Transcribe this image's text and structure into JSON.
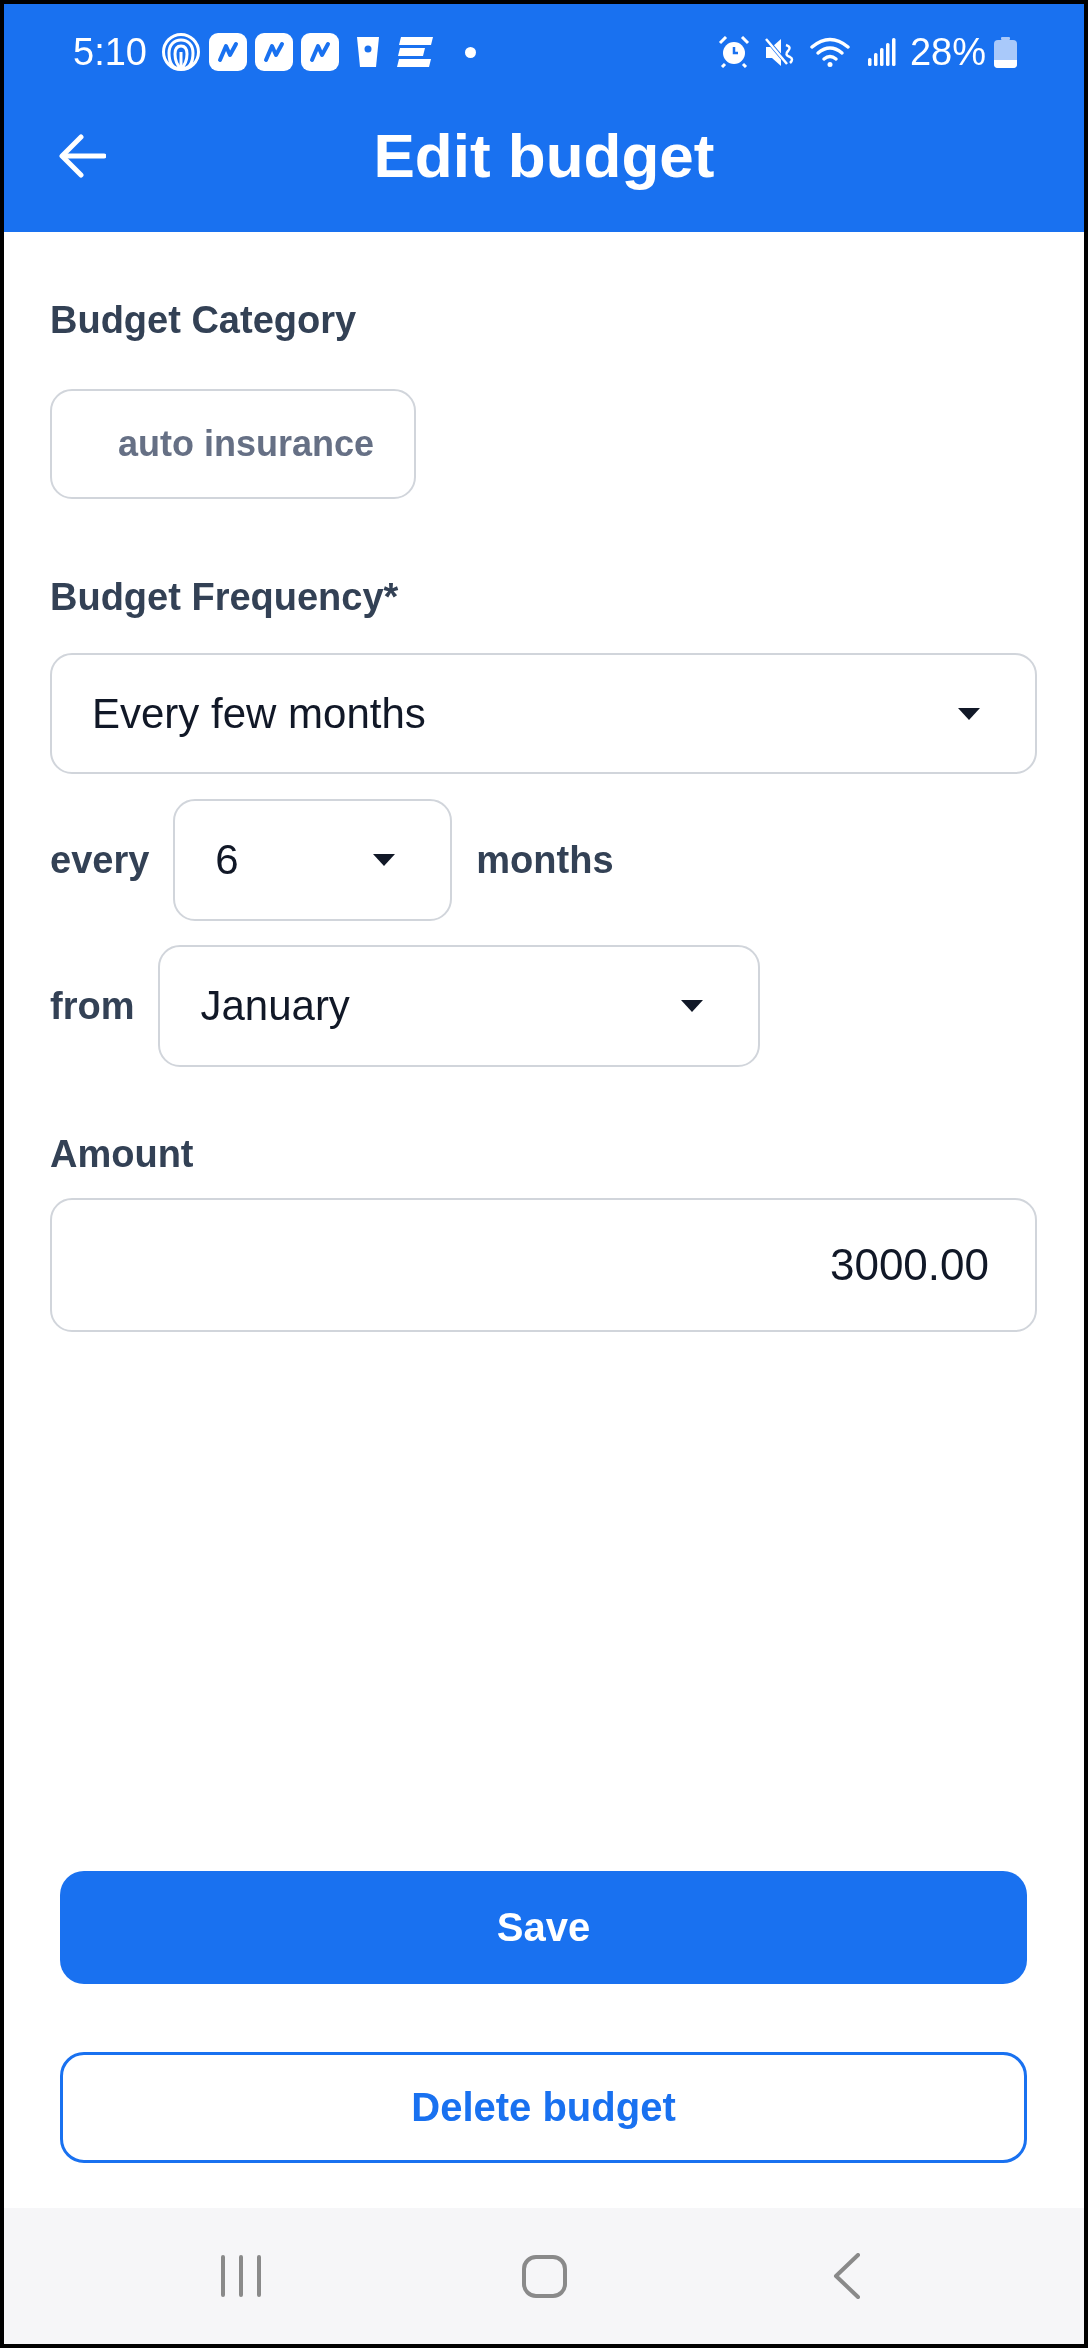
{
  "status_bar": {
    "time": "5:10",
    "battery": "28%"
  },
  "header": {
    "title": "Edit budget"
  },
  "form": {
    "category": {
      "label": "Budget Category",
      "value": "auto insurance"
    },
    "frequency": {
      "label": "Budget Frequency*",
      "value": "Every few months"
    },
    "interval": {
      "prefix": "every",
      "value": "6",
      "suffix": "months"
    },
    "start": {
      "prefix": "from",
      "value": "January"
    },
    "amount": {
      "label": "Amount",
      "value": "3000.00"
    }
  },
  "buttons": [
    {
      "kind": "primary",
      "label": "Save"
    },
    {
      "kind": "outline",
      "label": "Delete budget"
    }
  ]
}
